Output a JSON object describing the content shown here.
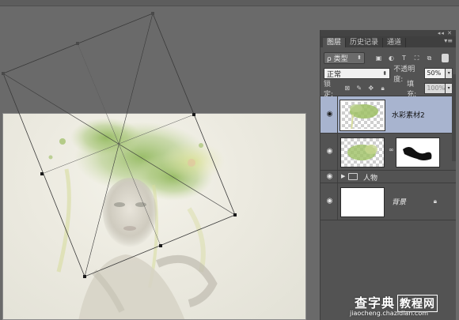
{
  "layers_panel": {
    "panel_controls": "◂◂ ✕",
    "tabs": [
      {
        "label": "图层",
        "active": true
      },
      {
        "label": "历史记录",
        "active": false
      },
      {
        "label": "通道",
        "active": false
      }
    ],
    "menu_icon": "▾≡",
    "filter": {
      "label": "ρ 类型",
      "icons": [
        "image-filter-icon",
        "adjustment-filter-icon",
        "type-filter-icon",
        "shape-filter-icon",
        "smart-object-filter-icon"
      ]
    },
    "blend_mode": "正常",
    "opacity_label": "不透明度:",
    "opacity_value": "50%",
    "lock_label": "锁定:",
    "fill_label": "填充:",
    "fill_value": "100%",
    "layers": [
      {
        "name": "水彩素材2",
        "active": true,
        "type": "pixel"
      },
      {
        "name": "",
        "active": false,
        "type": "masked"
      },
      {
        "name": "人物",
        "active": false,
        "type": "group"
      },
      {
        "name": "背景",
        "active": false,
        "type": "background",
        "locked": true
      }
    ]
  },
  "watermark": {
    "title_a": "查字典",
    "title_b": "教程网",
    "url": "jiaocheng.chazidian.com"
  },
  "colors": {
    "panel_bg": "#535353",
    "selected_layer": "#a8b4cf",
    "workspace": "#6a6a6a"
  }
}
